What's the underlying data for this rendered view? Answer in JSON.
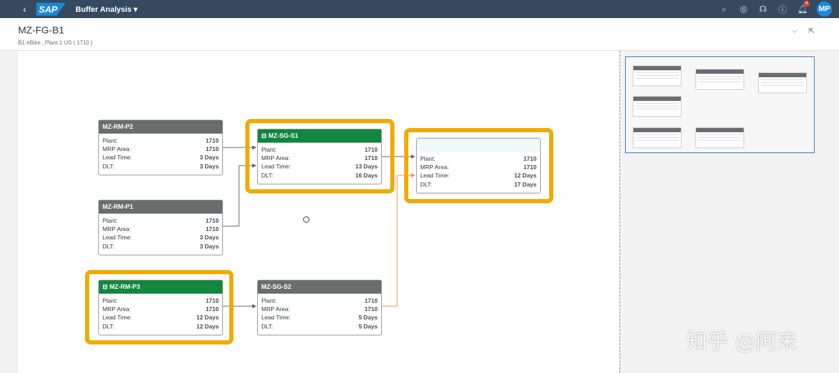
{
  "shell": {
    "back": "‹",
    "logo": "SAP",
    "app_title": "Buffer Analysis ▾",
    "notification_count": "6",
    "avatar": "MP"
  },
  "header": {
    "title": "MZ-FG-B1",
    "subtitle": "B1 eBike , Plant 1 US ( 1710 )",
    "collapse": "⌵",
    "share": "⇱"
  },
  "labels": {
    "plant": "Plant:",
    "mrp": "MRP Area:",
    "lead": "Lead Time:",
    "dlt": "DLT:"
  },
  "nodes": [
    {
      "id": "MZ-RM-P2",
      "icon": "",
      "plant": "1710",
      "mrp": "1710",
      "lead": "3 Days",
      "dlt": "3 Days"
    },
    {
      "id": "MZ-RM-P1",
      "icon": "",
      "plant": "1710",
      "mrp": "1710",
      "lead": "3 Days",
      "dlt": "3 Days"
    },
    {
      "id": "MZ-RM-P3",
      "icon": "⊟",
      "plant": "1710",
      "mrp": "1710",
      "lead": "12 Days",
      "dlt": "12 Days"
    },
    {
      "id": "MZ-SG-S1",
      "icon": "⊟",
      "plant": "1710",
      "mrp": "1710",
      "lead": "13 Days",
      "dlt": "16 Days"
    },
    {
      "id": "",
      "icon": "",
      "plant": "1710",
      "mrp": "1710",
      "lead": "12 Days",
      "dlt": "17 Days"
    },
    {
      "id": "MZ-SG-S2",
      "icon": "",
      "plant": "1710",
      "mrp": "1710",
      "lead": "5 Days",
      "dlt": "5 Days"
    }
  ],
  "colors": {
    "shell": "#354a5f",
    "buffer": "#11873f",
    "highlight": "#f0ab00",
    "decoupled_link": "#e8924a"
  },
  "watermark": "知乎 @阿来"
}
